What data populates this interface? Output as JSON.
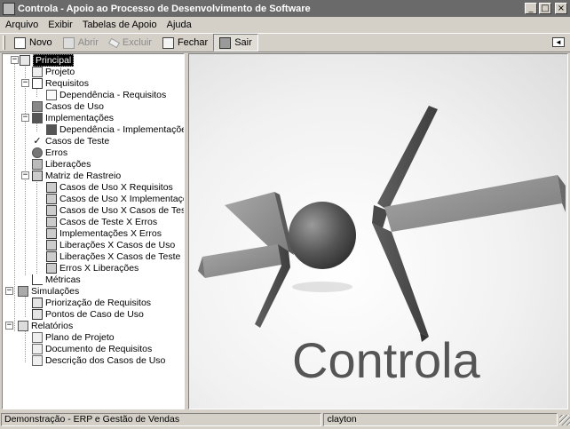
{
  "window": {
    "title": "Controla - Apoio ao Processo de Desenvolvimento de Software",
    "minimize": "_",
    "maximize": "□",
    "close": "×"
  },
  "menu": [
    "Arquivo",
    "Exibir",
    "Tabelas de Apoio",
    "Ajuda"
  ],
  "toolbar": {
    "novo": "Novo",
    "abrir": "Abrir",
    "excluir": "Excluir",
    "fechar": "Fechar",
    "sair": "Sair"
  },
  "tree": {
    "principal": "Principal",
    "projeto": "Projeto",
    "requisitos": "Requisitos",
    "dep_requisitos": "Dependência - Requisitos",
    "casos_uso": "Casos de Uso",
    "implementacoes": "Implementações",
    "dep_implementacoes": "Dependência - Implementações",
    "casos_teste": "Casos de Teste",
    "erros": "Erros",
    "liberacoes": "Liberações",
    "matriz": "Matriz de Rastreio",
    "m1": "Casos de Uso X Requisitos",
    "m2": "Casos de Uso X Implementações",
    "m3": "Casos de Uso X Casos de Teste",
    "m4": "Casos de Teste X Erros",
    "m5": "Implementações X Erros",
    "m6": "Liberações X Casos de Uso",
    "m7": "Liberações X Casos de Teste",
    "m8": "Erros X Liberações",
    "metricas": "Métricas",
    "simulacoes": "Simulações",
    "s1": "Priorização de Requisitos",
    "s2": "Pontos de Caso de Uso",
    "relatorios": "Relatórios",
    "r1": "Plano de Projeto",
    "r2": "Documento de Requisitos",
    "r3": "Descrição dos Casos de Uso"
  },
  "toggles": {
    "minus": "−",
    "plus": "+"
  },
  "splash": {
    "brand": "Controla"
  },
  "status": {
    "left": "Demonstração - ERP e Gestão de Vendas",
    "right": "clayton"
  }
}
